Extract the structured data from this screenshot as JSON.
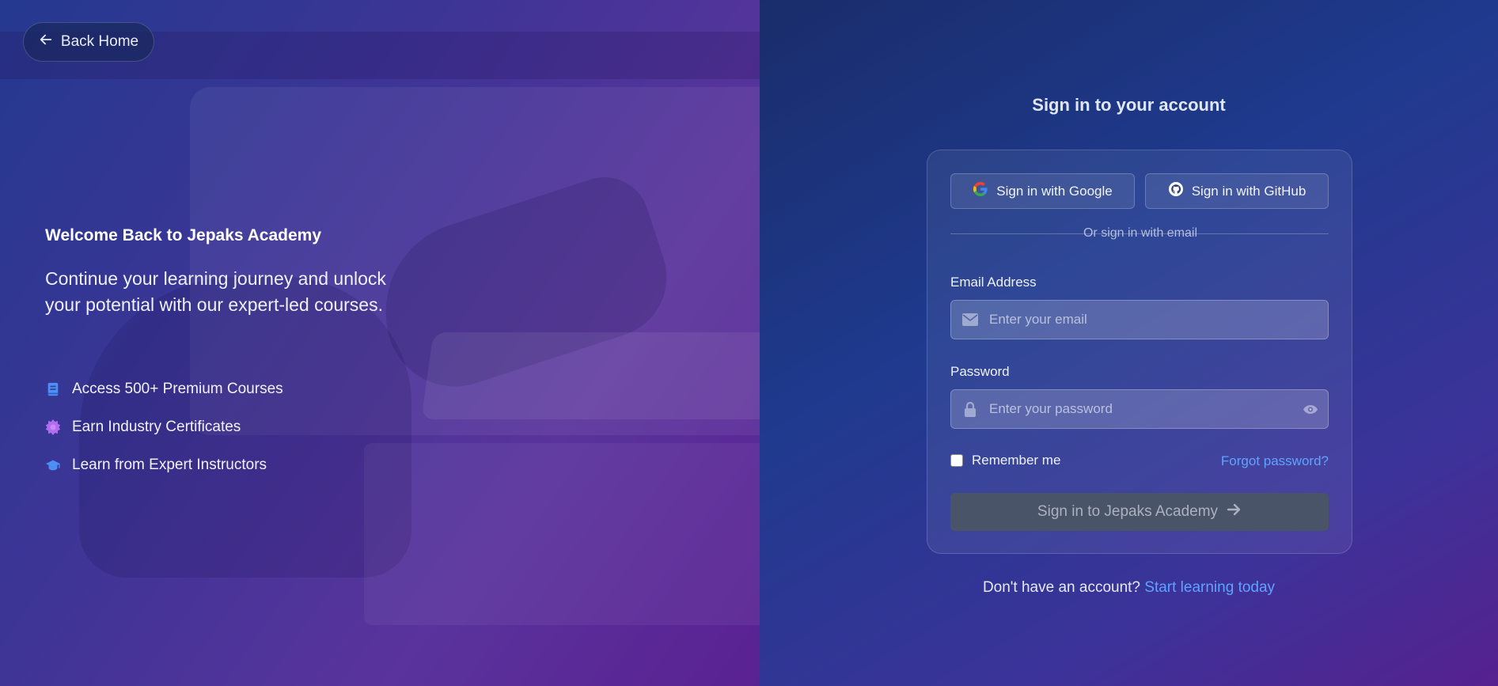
{
  "back_home": {
    "label": "Back Home"
  },
  "hero": {
    "welcome": "Welcome Back to Jepaks Academy",
    "tagline": "Continue your learning journey and unlock your potential with our expert-led courses.",
    "features": [
      {
        "label": "Access 500+ Premium Courses",
        "icon": "book-icon"
      },
      {
        "label": "Earn Industry Certificates",
        "icon": "certificate-icon"
      },
      {
        "label": "Learn from Expert Instructors",
        "icon": "graduation-cap-icon"
      }
    ]
  },
  "signin": {
    "title": "Sign in to your account",
    "google_label": "Sign in with Google",
    "github_label": "Sign in with GitHub",
    "divider_text": "Or sign in with email",
    "email_label": "Email Address",
    "email_placeholder": "Enter your email",
    "password_label": "Password",
    "password_placeholder": "Enter your password",
    "remember_label": "Remember me",
    "forgot_label": "Forgot password?",
    "submit_label": "Sign in to Jepaks Academy",
    "signup_prompt": "Don't have an account?",
    "signup_link": "Start learning today"
  },
  "colors": {
    "link": "#5ea3ff",
    "submit_bg": "#4a5468",
    "feature_icon_blue": "#4f8ef7",
    "feature_icon_purple": "#b36bf0"
  }
}
